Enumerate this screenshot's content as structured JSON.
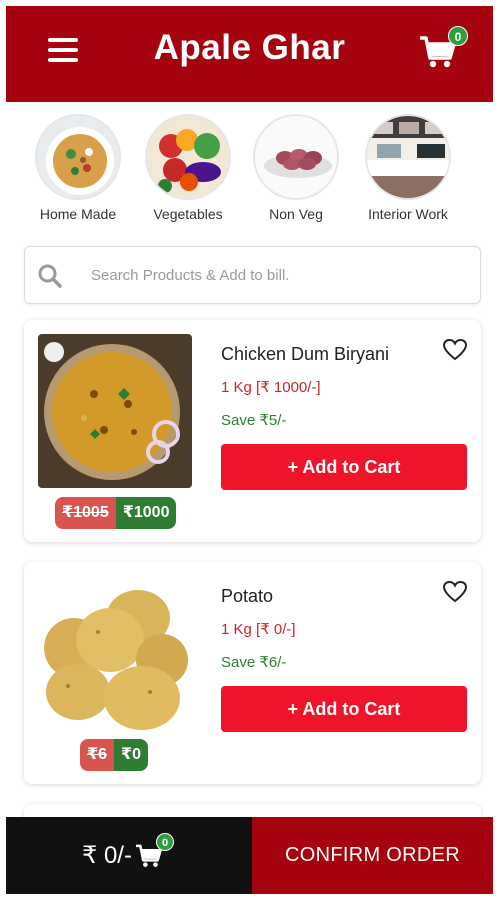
{
  "header": {
    "title": "Apale Ghar",
    "cart_count": "0",
    "menu_icon": "hamburger-menu-icon",
    "cart_icon": "shopping-cart-icon"
  },
  "categories": [
    {
      "label": "Home Made"
    },
    {
      "label": "Vegetables"
    },
    {
      "label": "Non Veg"
    },
    {
      "label": "Interior Work"
    }
  ],
  "search": {
    "placeholder": "Search Products & Add to bill.",
    "icon": "search-icon"
  },
  "products": [
    {
      "name": "Chicken Dum Biryani",
      "quantity": "1 Kg [₹ 1000/-]",
      "save": "Save ₹5/-",
      "mrp": "₹1005",
      "price": "₹1000",
      "add_label": "+ Add to Cart"
    },
    {
      "name": "Potato",
      "quantity": "1 Kg [₹ 0/-]",
      "save": "Save ₹6/-",
      "mrp": "₹6",
      "price": "₹0",
      "add_label": "+ Add to Cart"
    }
  ],
  "bottom_bar": {
    "total": "₹ 0/-",
    "cart_count": "0",
    "confirm_label": "CONFIRM ORDER"
  },
  "colors": {
    "brand": "#a5030e",
    "add_button": "#f0142a",
    "save_green": "#2e7d32",
    "badge_green": "#2f9c3e"
  }
}
